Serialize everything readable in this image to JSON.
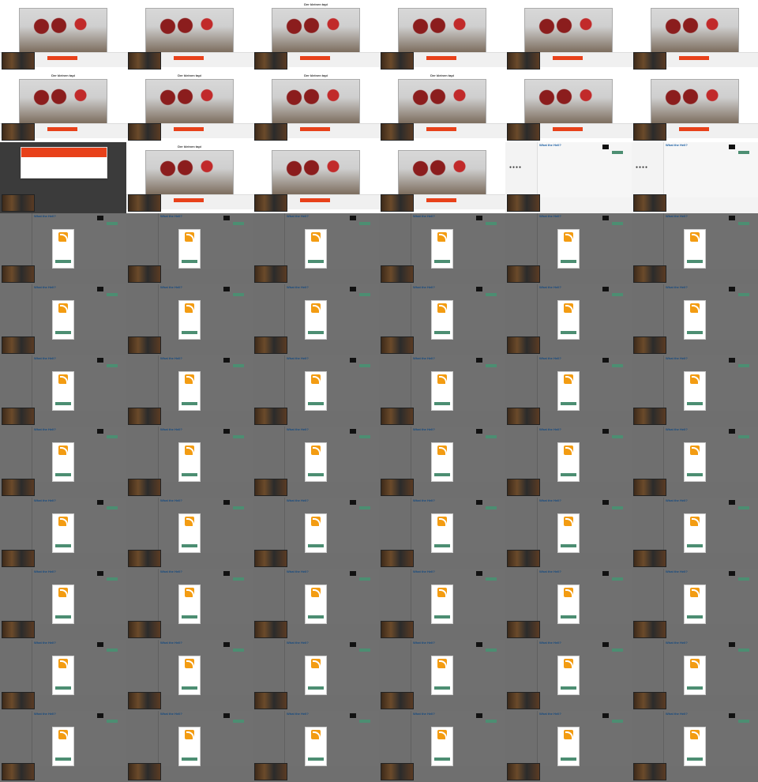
{
  "app": {
    "window_title": ""
  },
  "grid": {
    "columns": 6,
    "rows": 11,
    "cell_size": "160x90"
  },
  "tiles": {
    "top": [
      {
        "variant": "photo_with_orange_button",
        "headline": "",
        "subline": "",
        "button_label": ""
      },
      {
        "variant": "photo",
        "headline": "",
        "subline": "",
        "button_label": ""
      },
      {
        "variant": "photo_with_headline",
        "headline": "Der kleinen tapi",
        "subline": "",
        "button_label": ""
      },
      {
        "variant": "photo",
        "headline": "",
        "subline": "",
        "button_label": ""
      },
      {
        "variant": "photo",
        "headline": "",
        "subline": "",
        "button_label": ""
      },
      {
        "variant": "photo",
        "headline": "",
        "subline": "",
        "button_label": ""
      },
      {
        "variant": "photo_with_headline",
        "headline": "Der kleinen tapi",
        "subline": "",
        "button_label": ""
      },
      {
        "variant": "photo_with_headline",
        "headline": "Der kleinen tapi",
        "subline": "",
        "button_label": ""
      },
      {
        "variant": "photo_with_headline",
        "headline": "Der kleinen tapi",
        "subline": "",
        "button_label": ""
      },
      {
        "variant": "photo_with_headline",
        "headline": "Der kleinen tapi",
        "subline": "",
        "button_label": ""
      },
      {
        "variant": "photo",
        "headline": "",
        "subline": "",
        "button_label": ""
      },
      {
        "variant": "photo",
        "headline": "",
        "subline": "",
        "button_label": ""
      },
      {
        "variant": "dark_overlay_modal",
        "headline": "",
        "subline": "",
        "button_label": ""
      },
      {
        "variant": "photo_with_headline",
        "headline": "Der kleinen tapi",
        "subline": "",
        "button_label": ""
      },
      {
        "variant": "photo",
        "headline": "",
        "subline": "",
        "button_label": ""
      },
      {
        "variant": "photo",
        "headline": "",
        "subline": "",
        "button_label": ""
      },
      {
        "variant": "panel_with_icons",
        "headline": "",
        "subline": "",
        "button_label": ""
      },
      {
        "variant": "panel_with_icons",
        "headline": "",
        "subline": "",
        "button_label": ""
      }
    ],
    "rss_rows": 8,
    "rss_cols": 6
  },
  "panel": {
    "title": "What the Hell?",
    "subtitle": "",
    "cta_label": ""
  },
  "rss_card": {
    "title": "",
    "body": "",
    "button_label": ""
  },
  "colors": {
    "accent": "#e8411a",
    "rss": "#f39c12",
    "cta": "#4c8e72",
    "background": "#7a7a7a"
  }
}
